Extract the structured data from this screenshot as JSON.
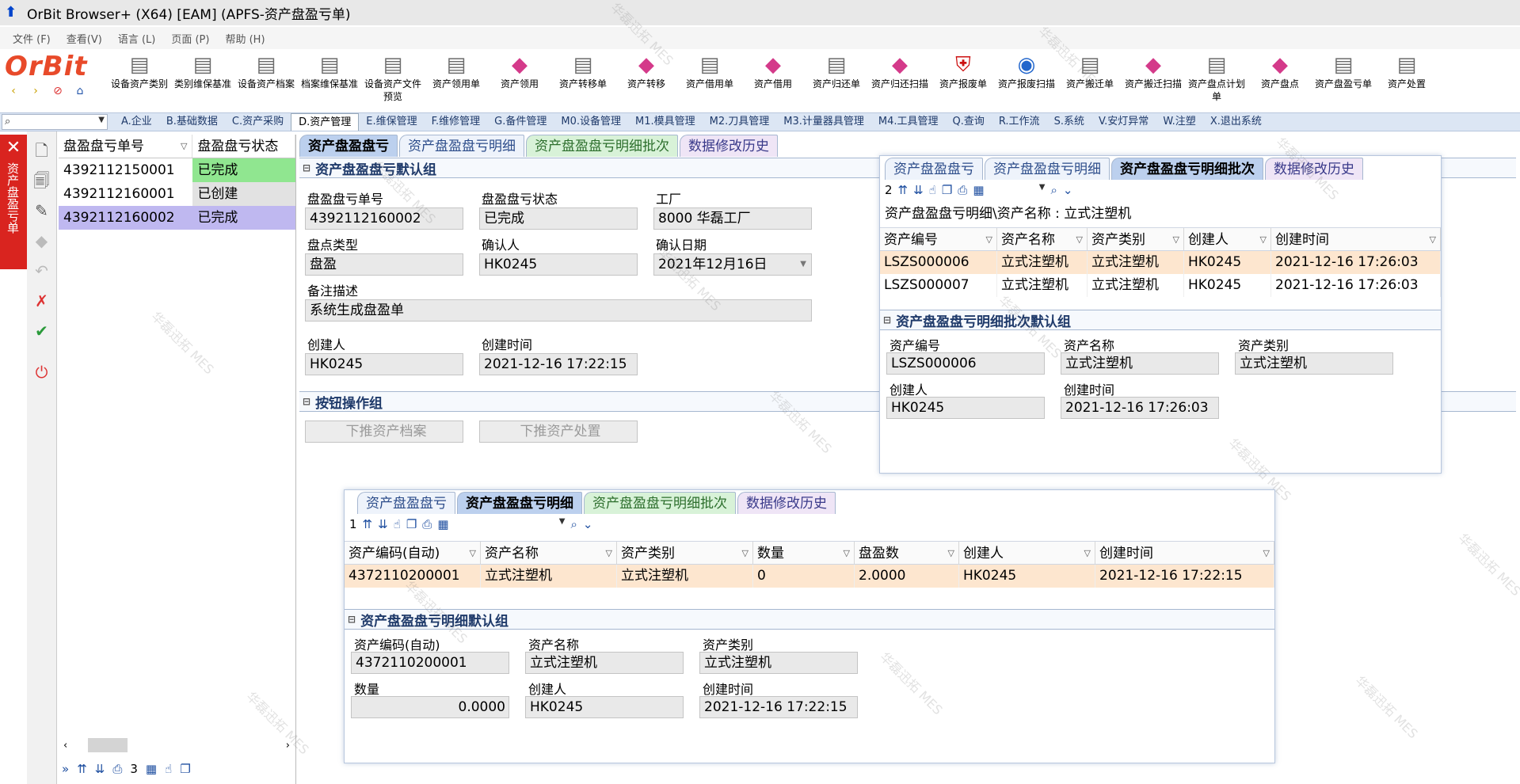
{
  "window": {
    "title": "OrBit Browser+ (X64) [EAM] (APFS-资产盘盈亏单)"
  },
  "menu": [
    "文件 (F)",
    "查看(V)",
    "语言 (L)",
    "页面 (P)",
    "帮助 (H)"
  ],
  "logo": "OrBit",
  "toolbar": [
    {
      "label": "设备资产类别",
      "icon": "doc-icon"
    },
    {
      "label": "类别维保基准",
      "icon": "doc-icon"
    },
    {
      "label": "设备资产档案",
      "icon": "doc-icon"
    },
    {
      "label": "档案维保基准",
      "icon": "doc-icon"
    },
    {
      "label": "设备资产文件预览",
      "icon": "doc-icon"
    },
    {
      "label": "资产领用单",
      "icon": "doc-icon"
    },
    {
      "label": "资产领用",
      "icon": "cube-icon"
    },
    {
      "label": "资产转移单",
      "icon": "doc-icon"
    },
    {
      "label": "资产转移",
      "icon": "cube-icon"
    },
    {
      "label": "资产借用单",
      "icon": "doc-icon"
    },
    {
      "label": "资产借用",
      "icon": "cube-icon"
    },
    {
      "label": "资产归还单",
      "icon": "doc-icon"
    },
    {
      "label": "资产归还扫描",
      "icon": "cube-icon"
    },
    {
      "label": "资产报废单",
      "icon": "shield-icon"
    },
    {
      "label": "资产报废扫描",
      "icon": "globe-icon"
    },
    {
      "label": "资产搬迁单",
      "icon": "doc-icon"
    },
    {
      "label": "资产搬迁扫描",
      "icon": "cube-icon"
    },
    {
      "label": "资产盘点计划单",
      "icon": "doc-icon"
    },
    {
      "label": "资产盘点",
      "icon": "cube-icon"
    },
    {
      "label": "资产盘盈亏单",
      "icon": "doc-icon"
    },
    {
      "label": "资产处置",
      "icon": "doc-icon"
    }
  ],
  "nav_tabs": [
    "A.企业",
    "B.基础数据",
    "C.资产采购",
    "D.资产管理",
    "E.维保管理",
    "F.维修管理",
    "G.备件管理",
    "M0.设备管理",
    "M1.模具管理",
    "M2.刀具管理",
    "M3.计量器具管理",
    "M4.工具管理",
    "Q.查询",
    "R.工作流",
    "S.系统",
    "V.安灯异常",
    "W.注塑",
    "X.退出系统"
  ],
  "nav_active": "D.资产管理",
  "left_strip": {
    "label": "资产盘盈亏单"
  },
  "list": {
    "headers": [
      "盘盈盘亏单号",
      "盘盈盘亏状态"
    ],
    "rows": [
      {
        "no": "4392112150001",
        "status": "已完成"
      },
      {
        "no": "4392112160001",
        "status": "已创建"
      },
      {
        "no": "4392112160002",
        "status": "已完成"
      }
    ],
    "page_count": "3"
  },
  "main_tabs": [
    "资产盘盈盘亏",
    "资产盘盈盘亏明细",
    "资产盘盈盘亏明细批次",
    "数据修改历史"
  ],
  "main_form": {
    "group_title": "资产盘盈盘亏默认组",
    "fields": {
      "order_no_label": "盘盈盘亏单号",
      "order_no": "4392112160002",
      "status_label": "盘盈盘亏状态",
      "status": "已完成",
      "factory_label": "工厂",
      "factory": "8000 华磊工厂",
      "check_type_label": "盘点类型",
      "check_type": "盘盈",
      "confirmer_label": "确认人",
      "confirmer": "HK0245",
      "confirm_date_label": "确认日期",
      "confirm_date": "2021年12月16日",
      "remark_label": "备注描述",
      "remark": "系统生成盘盈单",
      "creator_label": "创建人",
      "creator": "HK0245",
      "created_label": "创建时间",
      "created": "2021-12-16 17:22:15"
    },
    "btn_group_title": "按钮操作组",
    "btn_push_archive": "下推资产档案",
    "btn_push_dispose": "下推资产处置"
  },
  "batch_panel": {
    "tabs": [
      "资产盘盈盘亏",
      "资产盘盈盘亏明细",
      "资产盘盈盘亏明细批次",
      "数据修改历史"
    ],
    "count": "2",
    "breadcrumb": "资产盘盈盘亏明细\\资产名称 : 立式注塑机",
    "headers": [
      "资产编号",
      "资产名称",
      "资产类别",
      "创建人",
      "创建时间"
    ],
    "rows": [
      [
        "LSZS000006",
        "立式注塑机",
        "立式注塑机",
        "HK0245",
        "2021-12-16 17:26:03"
      ],
      [
        "LSZS000007",
        "立式注塑机",
        "立式注塑机",
        "HK0245",
        "2021-12-16 17:26:03"
      ]
    ],
    "group_title": "资产盘盈盘亏明细批次默认组",
    "form": {
      "code_label": "资产编号",
      "code": "LSZS000006",
      "name_label": "资产名称",
      "name": "立式注塑机",
      "cat_label": "资产类别",
      "cat": "立式注塑机",
      "creator_label": "创建人",
      "creator": "HK0245",
      "created_label": "创建时间",
      "created": "2021-12-16 17:26:03"
    }
  },
  "detail_panel": {
    "tabs": [
      "资产盘盈盘亏",
      "资产盘盈盘亏明细",
      "资产盘盈盘亏明细批次",
      "数据修改历史"
    ],
    "count": "1",
    "headers": [
      "资产编码(自动)",
      "资产名称",
      "资产类别",
      "数量",
      "盘盈数",
      "创建人",
      "创建时间"
    ],
    "rows": [
      [
        "4372110200001",
        "立式注塑机",
        "立式注塑机",
        "0",
        "2.0000",
        "HK0245",
        "2021-12-16 17:22:15"
      ]
    ],
    "group_title": "资产盘盈盘亏明细默认组",
    "form": {
      "code_label": "资产编码(自动)",
      "code": "4372110200001",
      "name_label": "资产名称",
      "name": "立式注塑机",
      "cat_label": "资产类别",
      "cat": "立式注塑机",
      "qty_label": "数量",
      "qty": "0.0000",
      "creator_label": "创建人",
      "creator": "HK0245",
      "created_label": "创建时间",
      "created": "2021-12-16 17:22:15"
    }
  },
  "watermark": "华磊迅拓 MES"
}
